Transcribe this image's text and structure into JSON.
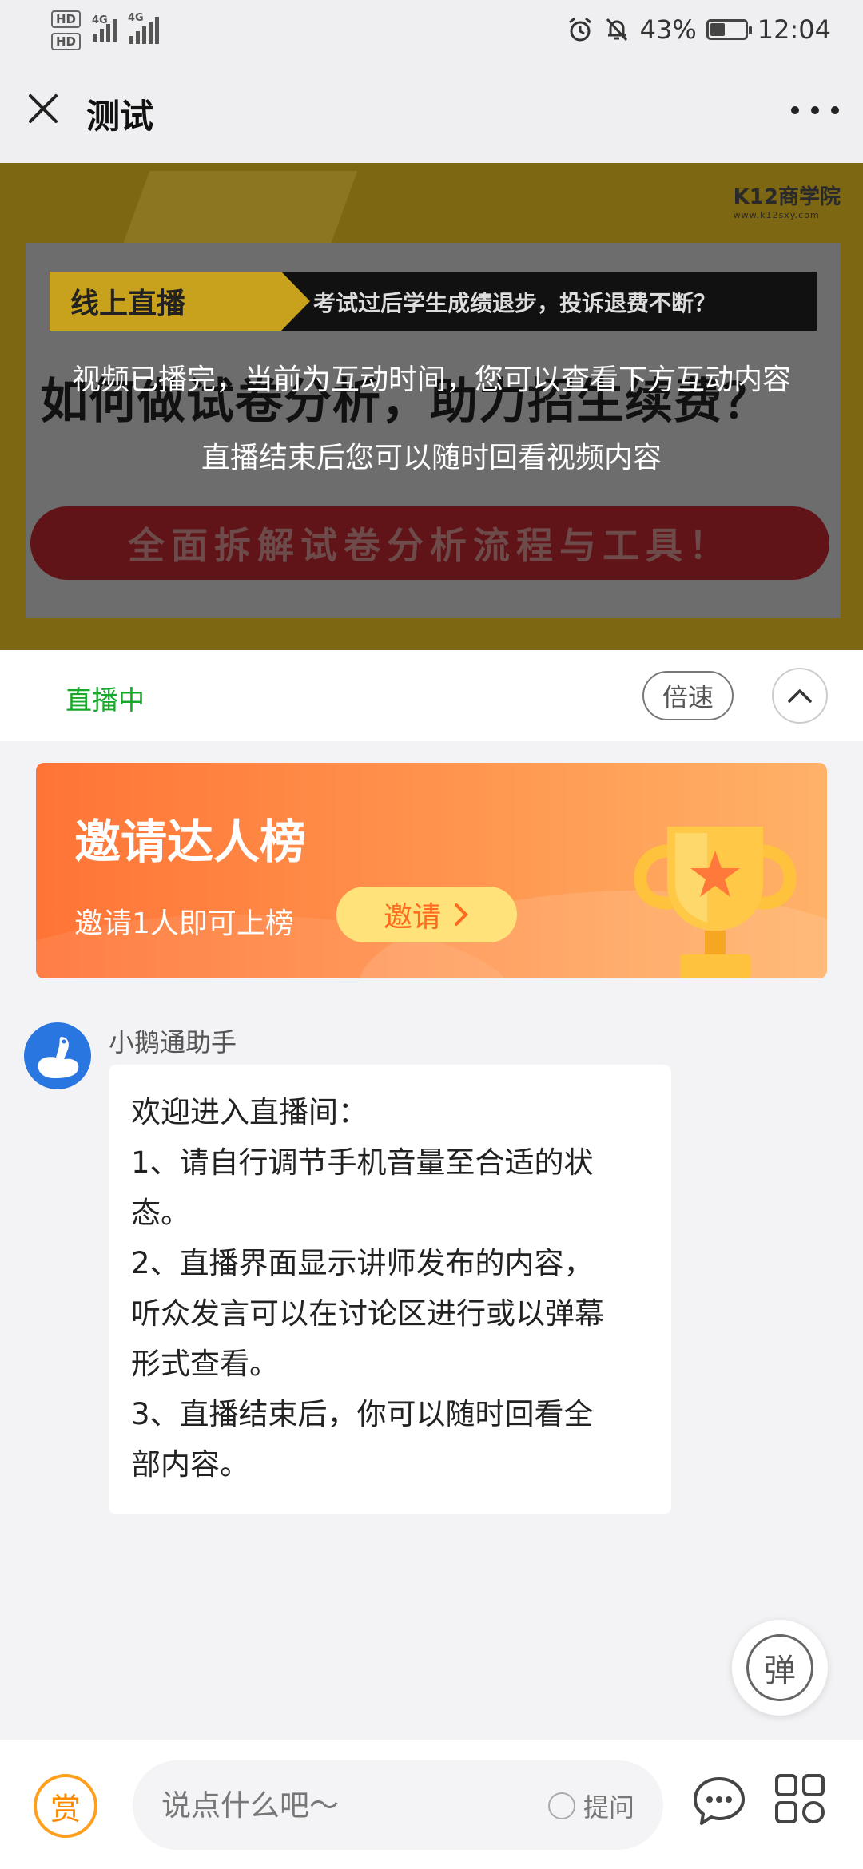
{
  "status_bar": {
    "hd1": "HD",
    "hd2": "HD",
    "net1": "4G",
    "net2": "4G",
    "battery_percent": "43%",
    "battery_level": 0.43,
    "time": "12:04",
    "icons": [
      "alarm-icon",
      "mute-bell-icon",
      "battery-icon",
      "signal-icon"
    ]
  },
  "nav": {
    "title": "测试",
    "icons": [
      "close-icon",
      "more-icon"
    ]
  },
  "video": {
    "brand": "K12商学院",
    "brand_url": "www.k12sxy.com",
    "poster_tag": "线上直播",
    "poster_subtitle": "考试过后学生成绩退步，投诉退费不断？",
    "poster_title": "如何做试卷分析，助力招生续费？",
    "poster_pill": "全面拆解试卷分析流程与工具！",
    "overlay_line1": "视频已播完，当前为互动时间，您可以查看下方互动内容",
    "overlay_line2": "直播结束后您可以随时回看视频内容"
  },
  "live_bar": {
    "status": "直播中",
    "speed_label": "倍速",
    "icons": [
      "chevron-up-icon"
    ]
  },
  "invite_banner": {
    "title": "邀请达人榜",
    "subtitle": "邀请1人即可上榜",
    "button_label": "邀请",
    "icons": [
      "trophy-icon",
      "chevron-right-icon"
    ]
  },
  "message": {
    "sender": "小鹅通助手",
    "lines": [
      "欢迎进入直播间：",
      "1、请自行调节手机音量至合适的状",
      "态。",
      "2、直播界面显示讲师发布的内容，",
      "听众发言可以在讨论区进行或以弹幕",
      "形式查看。",
      "3、直播结束后，你可以随时回看全",
      "部内容。"
    ]
  },
  "danmu": {
    "label": "弹"
  },
  "bottom_bar": {
    "reward_label": "赏",
    "input_placeholder": "说点什么吧～",
    "ask_label": "提问",
    "icons": [
      "chat-bubble-icon",
      "grid-menu-icon"
    ]
  },
  "colors": {
    "live_green": "#17a82a",
    "invite_orange": "#ff7436",
    "invite_button": "#ffe37a",
    "reward_orange": "#ff9f1c",
    "avatar_blue": "#2a76e0"
  }
}
